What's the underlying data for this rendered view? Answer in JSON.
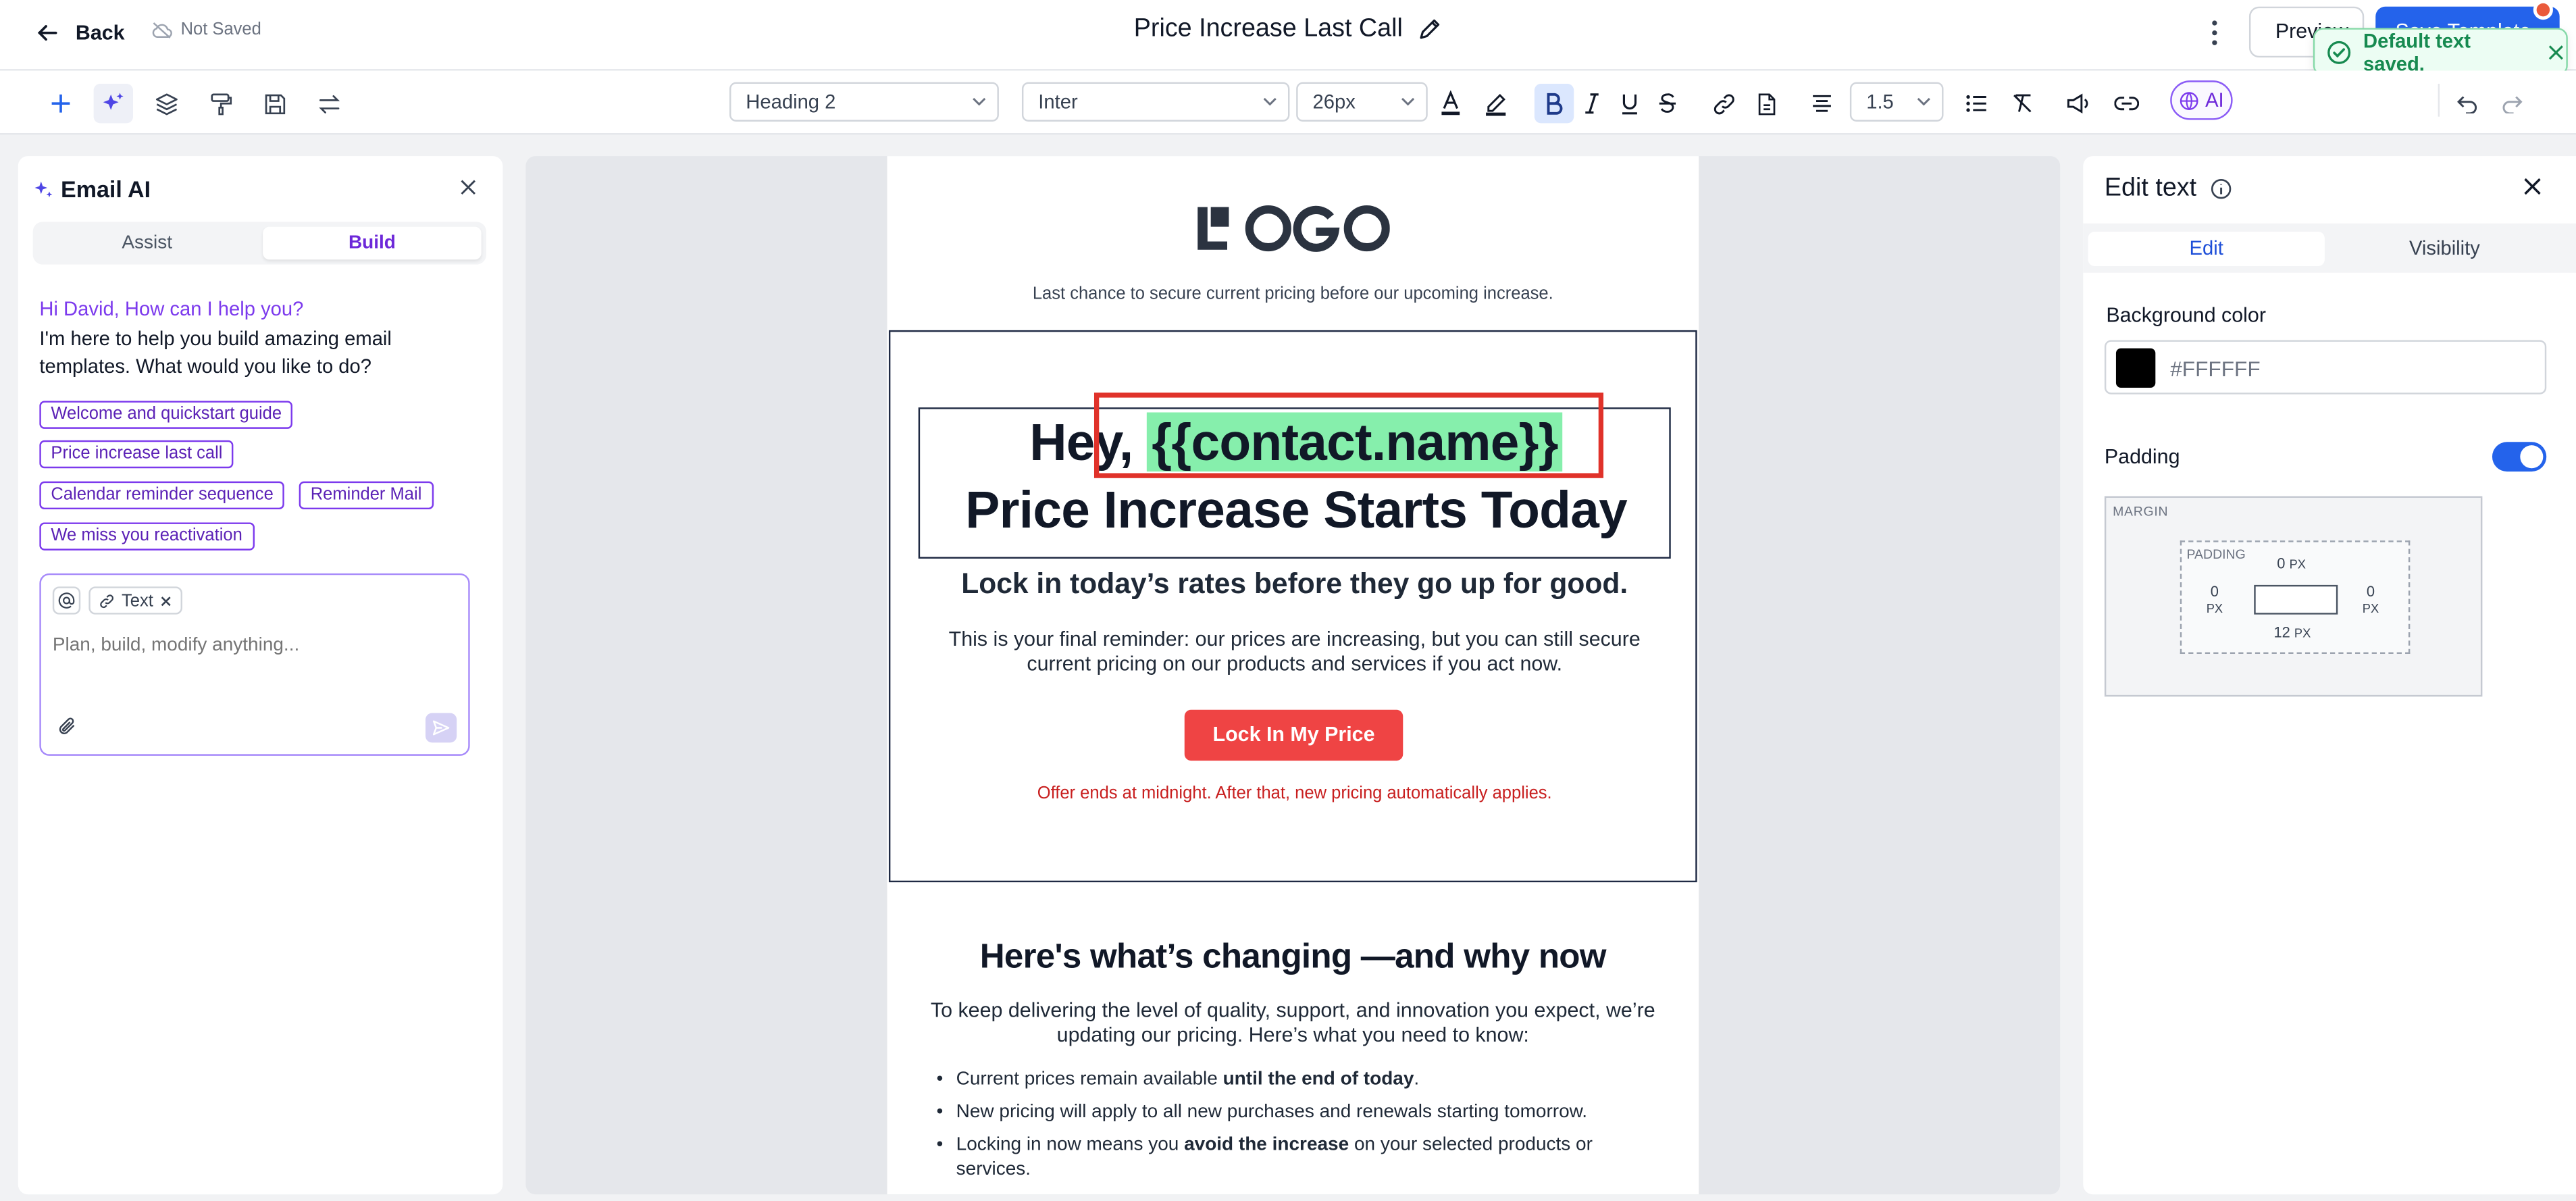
{
  "topbar": {
    "back_label": "Back",
    "save_status": "Not Saved",
    "doc_title": "Price Increase Last Call",
    "preview_label": "Preview",
    "save_template_label": "Save Template",
    "toast": "Default text saved."
  },
  "toolbar": {
    "block_style": "Heading 2",
    "font_family": "Inter",
    "font_size": "26px",
    "line_height": "1.5",
    "ai_label": "AI"
  },
  "left_panel": {
    "title": "Email AI",
    "tabs": [
      "Assist",
      "Build"
    ],
    "active_tab": "Build",
    "greeting": "Hi David, How can I help you?",
    "intro": "I'm here to help you build amazing email templates. What would you like to do?",
    "suggestions": [
      "Welcome and quickstart guide",
      "Price increase last call",
      "Calendar reminder sequence",
      "Reminder Mail",
      "We miss you reactivation"
    ],
    "context_chip": "Text",
    "prompt_placeholder": "Plan, build, modify anything..."
  },
  "email": {
    "logo_text": "LOGO",
    "tagline": "Last chance to secure current pricing before our upcoming increase.",
    "hero_greeting": "Hey,",
    "hero_variable": "{{contact.name}}",
    "hero_line2": "Price Increase Starts Today",
    "subheading": "Lock in today’s rates before they go up for good.",
    "body": "This is your final reminder: our prices are increasing, but you can still secure current pricing on our products and services if you act now.",
    "cta": "Lock In My Price",
    "offer_note": "Offer ends at midnight. After that, new pricing automatically applies.",
    "section2_title": "Here's what’s changing —and why now",
    "section2_body": "To keep delivering the level of quality, support, and innovation you expect, we’re updating our pricing. Here’s what you need to know:",
    "bullets": [
      {
        "pre": "Current prices remain available ",
        "bold": "until the end of today",
        "post": "."
      },
      {
        "pre": "New pricing will apply to all new purchases and renewals starting tomorrow.",
        "bold": "",
        "post": ""
      },
      {
        "pre": "Locking in now means you ",
        "bold": "avoid the increase",
        "post": " on your selected products or services."
      }
    ]
  },
  "right_panel": {
    "title": "Edit text",
    "tabs": [
      "Edit",
      "Visibility"
    ],
    "active_tab": "Edit",
    "bg_color_label": "Background color",
    "bg_color_value": "#FFFFFF",
    "bg_swatch_color": "#000000",
    "padding_label": "Padding",
    "padding_enabled": true,
    "margin_label": "MARGIN",
    "padding_box_label": "PADDING",
    "padding": {
      "top": "0",
      "right": "0",
      "bottom": "12",
      "left": "0",
      "unit": "PX"
    }
  },
  "colors": {
    "accent": "#2463eb",
    "ai_purple": "#7c3aed",
    "cta_red": "#ef4444",
    "highlight": "#86efac"
  }
}
